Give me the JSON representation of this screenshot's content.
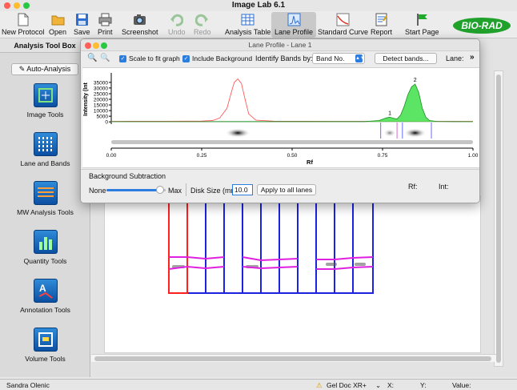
{
  "window": {
    "title": "Image Lab 6.1"
  },
  "toolbar": {
    "items": [
      {
        "label": "New Protocol",
        "icon": "new-document-icon"
      },
      {
        "label": "Open",
        "icon": "folder-icon"
      },
      {
        "label": "Save",
        "icon": "floppy-disk-icon"
      },
      {
        "label": "Print",
        "icon": "printer-icon"
      },
      {
        "label": "Screenshot",
        "icon": "camera-icon"
      },
      {
        "label": "Undo",
        "icon": "undo-icon",
        "disabled": true
      },
      {
        "label": "Redo",
        "icon": "redo-icon",
        "disabled": true
      },
      {
        "label": "Analysis Table",
        "icon": "table-icon"
      },
      {
        "label": "Lane Profile",
        "icon": "lane-profile-icon",
        "selected": true
      },
      {
        "label": "Standard Curve",
        "icon": "standard-curve-icon"
      },
      {
        "label": "Report",
        "icon": "report-icon"
      },
      {
        "label": "Start Page",
        "icon": "flag-icon"
      }
    ],
    "brand": "BIO-RAD"
  },
  "sidebar": {
    "header": "Analysis Tool Box",
    "auto_analysis": "Auto-Analysis",
    "tools": [
      {
        "label": "Image Tools",
        "icon": "image-tools-icon"
      },
      {
        "label": "Lane and Bands",
        "icon": "lane-bands-icon"
      },
      {
        "label": "MW Analysis Tools",
        "icon": "mw-analysis-icon"
      },
      {
        "label": "Quantity Tools",
        "icon": "quantity-tools-icon"
      },
      {
        "label": "Annotation Tools",
        "icon": "annotation-tools-icon"
      },
      {
        "label": "Volume Tools",
        "icon": "volume-tools-icon"
      }
    ]
  },
  "dialog": {
    "title": "Lane Profile - Lane 1",
    "scale_to_fit": {
      "label": "Scale to fit graph",
      "checked": true
    },
    "include_background": {
      "label": "Include Background",
      "checked": true
    },
    "identify_label": "Identify Bands by:",
    "identify_value": "Band No.",
    "detect_button": "Detect bands...",
    "lane_label": "Lane:",
    "more_glyph": "»",
    "bg_section_title": "Background Subtraction",
    "slider_min": "None",
    "slider_max": "Max",
    "slider_level": 0.9,
    "disk_size_label": "Disk Size (mm):",
    "disk_size_value": "10.0",
    "apply_button": "Apply to all lanes",
    "rf_label": "Rf:",
    "int_label": "Int:"
  },
  "chart_data": {
    "type": "line",
    "ylabel": "Intensity (Int",
    "xlabel": "Rf",
    "yticks": [
      0,
      5000,
      10000,
      15000,
      20000,
      25000,
      30000,
      35000
    ],
    "xticks": [
      0.0,
      0.25,
      0.5,
      0.75,
      1.0
    ],
    "xtick_labels": [
      "0.00",
      "0.25",
      "0.50",
      "0.75",
      "1.00"
    ],
    "xlim": [
      0,
      1
    ],
    "ylim": [
      -2000,
      42000
    ],
    "series": [
      {
        "role": "reference-lane",
        "color": "#ff5a5a",
        "filled": false,
        "x": [
          0.0,
          0.05,
          0.1,
          0.15,
          0.2,
          0.25,
          0.28,
          0.3,
          0.32,
          0.33,
          0.34,
          0.35,
          0.36,
          0.37,
          0.38,
          0.4,
          0.45,
          0.5,
          0.55,
          0.6,
          0.65,
          0.7,
          0.75,
          0.78,
          0.8,
          0.82,
          0.84,
          0.86,
          0.88,
          0.9,
          0.95,
          1.0
        ],
        "y": [
          400,
          450,
          500,
          550,
          600,
          700,
          1200,
          3500,
          12000,
          24000,
          35000,
          38000,
          34000,
          20000,
          7000,
          1500,
          600,
          500,
          450,
          400,
          400,
          400,
          400,
          450,
          500,
          500,
          450,
          400,
          400,
          400,
          400,
          400
        ]
      },
      {
        "role": "current-lane",
        "color": "#1faa2a",
        "filled": true,
        "x": [
          0.0,
          0.1,
          0.2,
          0.3,
          0.4,
          0.5,
          0.6,
          0.7,
          0.74,
          0.76,
          0.77,
          0.78,
          0.79,
          0.8,
          0.81,
          0.82,
          0.83,
          0.84,
          0.85,
          0.86,
          0.87,
          0.88,
          0.9,
          0.95,
          1.0
        ],
        "y": [
          200,
          200,
          200,
          250,
          250,
          250,
          250,
          300,
          1200,
          3500,
          4200,
          3200,
          2500,
          6000,
          14000,
          24000,
          31000,
          33500,
          26000,
          12000,
          4000,
          1200,
          400,
          250,
          200
        ]
      }
    ],
    "band_labels": [
      {
        "label": "1",
        "x": 0.77,
        "y": 4200
      },
      {
        "label": "2",
        "x": 0.84,
        "y": 33500
      }
    ],
    "band_markers": [
      {
        "x": 0.745,
        "color": "#4444ff"
      },
      {
        "x": 0.79,
        "color": "#cc44cc"
      },
      {
        "x": 0.805,
        "color": "#4444ff"
      },
      {
        "x": 0.885,
        "color": "#4444ff"
      }
    ]
  },
  "gel": {
    "lanes_blue_count": 9,
    "selected_lane": 1
  },
  "status": {
    "user": "Sandra Olenic",
    "device": "Gel Doc XR+",
    "x_label": "X:",
    "y_label": "Y:",
    "value_label": "Value:"
  }
}
